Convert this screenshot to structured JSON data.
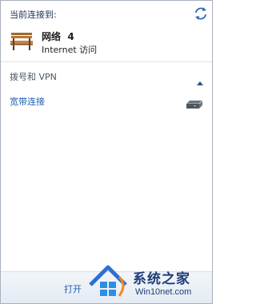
{
  "header": {
    "label": "当前连接到:",
    "refresh_icon": "refresh-icon"
  },
  "network": {
    "icon": "bench-icon",
    "name": "网络  4",
    "access": "Internet 访问"
  },
  "dialup_vpn": {
    "header": "拨号和 VPN",
    "collapse_icon": "chevron-up-icon",
    "connections": [
      {
        "label": "宽带连接",
        "icon": "modem-icon"
      }
    ]
  },
  "footer": {
    "link_label": "打开"
  },
  "watermark": {
    "title": "系统之家",
    "url": "Win10net.com"
  },
  "colors": {
    "link": "#1a5fb4",
    "header_text": "#1e3154",
    "border": "#a7b0bd",
    "footer_bg": "#e9eef5"
  }
}
